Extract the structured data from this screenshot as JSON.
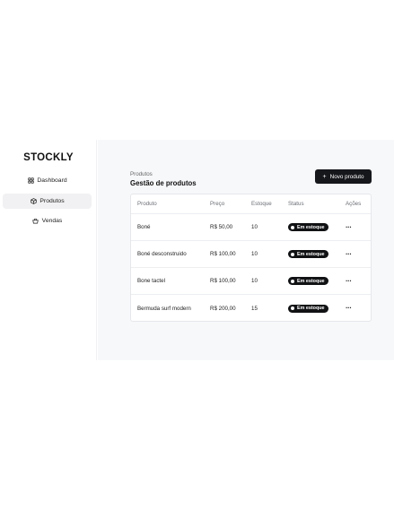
{
  "sidebar": {
    "logo": "STOCKLY",
    "items": [
      {
        "label": "Dashboard",
        "icon": "grid-icon",
        "active": false
      },
      {
        "label": "Produtos",
        "icon": "package-icon",
        "active": true
      },
      {
        "label": "Vendas",
        "icon": "basket-icon",
        "active": false
      }
    ]
  },
  "main": {
    "breadcrumb": "Produtos",
    "title": "Gestão de produtos",
    "new_button": {
      "label": "Novo produto",
      "icon": "plus-icon"
    }
  },
  "table": {
    "headers": [
      "Produto",
      "Preço",
      "Estoque",
      "Status",
      "Ações"
    ],
    "rows": [
      {
        "produto": "Boné",
        "preco": "R$ 50,00",
        "estoque": "10",
        "status": "Em estoque"
      },
      {
        "produto": "Boné desconstruido",
        "preco": "R$ 100,00",
        "estoque": "10",
        "status": "Em estoque"
      },
      {
        "produto": "Bone tactel",
        "preco": "R$ 100,00",
        "estoque": "10",
        "status": "Em estoque"
      },
      {
        "produto": "Bermuda surf modern",
        "preco": "R$ 200,00",
        "estoque": "15",
        "status": "Em estoque"
      }
    ],
    "actions_glyph": "···"
  },
  "colors": {
    "accent": "#16171b",
    "sidebar_active_bg": "#f1f1f3",
    "main_bg": "#f7f8fa",
    "badge_bg": "#111214"
  }
}
